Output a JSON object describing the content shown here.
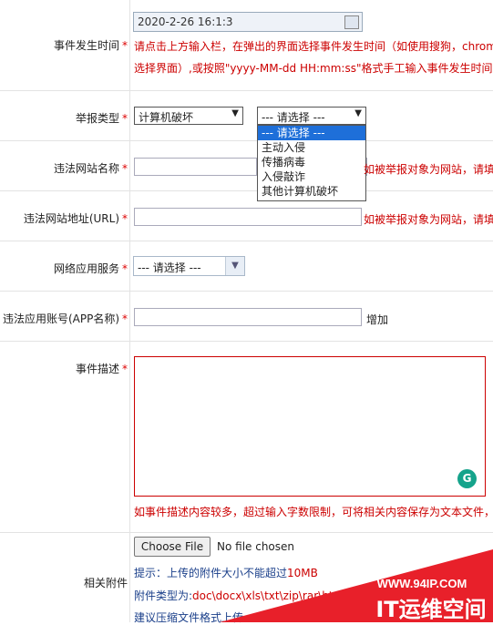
{
  "event_time": {
    "label": "事件发生时间",
    "value": "2020-2-26 16:1:3",
    "hint1": "请点击上方输入栏，在弹出的界面选择事件发生时间（如使用搜狗，chrome",
    "hint2": "选择界面）,或按照\"yyyy-MM-dd HH:mm:ss\"格式手工输入事件发生时间,如"
  },
  "report_type": {
    "label": "举报类型",
    "primary": "计算机破坏",
    "secondary": "--- 请选择 ---",
    "options": [
      "--- 请选择 ---",
      "主动入侵",
      "传播病毒",
      "入侵敲诈",
      "其他计算机破坏"
    ]
  },
  "site_name": {
    "label": "违法网站名称",
    "hint": "如被举报对象为网站，请填"
  },
  "site_url": {
    "label": "违法网站地址(URL)",
    "hint": "如被举报对象为网站，请填"
  },
  "app_service": {
    "label": "网络应用服务",
    "selected": "--- 请选择 ---"
  },
  "app_account": {
    "label": "违法应用账号(APP名称)",
    "add_label": "增加"
  },
  "description": {
    "label": "事件描述",
    "hint": "如事件描述内容较多，超过输入字数限制，可将相关内容保存为文本文件，"
  },
  "attachment": {
    "label": "相关附件",
    "button": "Choose File",
    "status": "No file chosen",
    "tip1_prefix": "提示：上传的附件大小不能超过",
    "tip1_size": "10MB",
    "tip2_prefix": "附件类型为:",
    "tip2_types": "doc\\docx\\xls\\txt\\zip\\rar\\htm\\ht",
    "tip3": "建议压缩文件格式上传"
  },
  "required_mark": "*",
  "watermark": {
    "url": "WWW.94IP.COM",
    "brand": "IT运维空间"
  },
  "colors": {
    "required": "#dd0000",
    "hint": "#cc0000",
    "dropdown_highlight": "#1e6fd9",
    "watermark": "#e8202a"
  }
}
